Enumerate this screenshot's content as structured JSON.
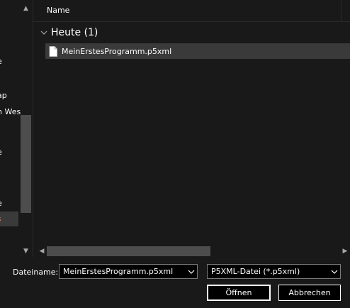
{
  "nav_pane": {
    "items": [
      {
        "label": "e"
      },
      {
        "label": "ap"
      },
      {
        "label": "n Wes"
      },
      {
        "label": "e"
      },
      {
        "label": "e"
      },
      {
        "label": "s"
      }
    ],
    "scroll_up": "▲",
    "scroll_down": "▼"
  },
  "file_list": {
    "column_name": "Name",
    "group": {
      "label": "Heute (1)"
    },
    "files": [
      {
        "name": "MeinErstesProgramm.p5xml"
      }
    ]
  },
  "h_scrollbar": {
    "left": "◀",
    "right": "▶"
  },
  "bottom": {
    "filename_label": "Dateiname:",
    "filename_value": "MeinErstesProgramm.p5xml",
    "filetype_value": "P5XML-Datei (*.p5xml)",
    "open_label": "Öffnen",
    "cancel_label": "Abbrechen"
  },
  "colors": {
    "background": "#191919",
    "selected_row": "#3a3a3a",
    "scroll_thumb": "#4d4d4d",
    "selected_nav_text": "#e76a4d"
  }
}
